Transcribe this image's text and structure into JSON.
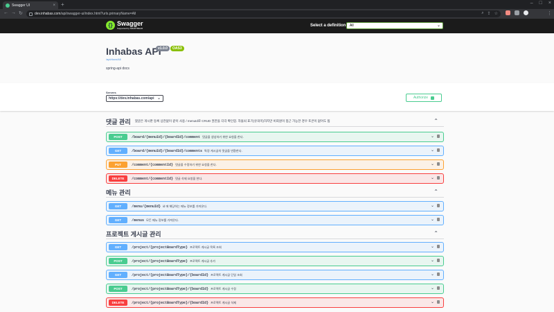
{
  "browser": {
    "tab_title": "Swagger UI",
    "url_host": "dev.inhabas.com",
    "url_path": "/api/swagger-ui/index.html?urls.primaryName=All"
  },
  "topbar": {
    "logo_text": "Swagger",
    "logo_sub": "Supported by SMARTBEAR",
    "definition_label": "Select a definition",
    "definition_value": "All"
  },
  "info": {
    "title": "Inhabas API",
    "version_badge": "v1.0.0",
    "oas_badge": "OAS3",
    "url": "/api/docs/All",
    "description": "spring-api docs"
  },
  "scheme": {
    "servers_label": "Servers",
    "server_value": "https://dev.inhabas.com/api",
    "authorize_label": "Authorize"
  },
  "sections": [
    {
      "name": "댓글 관리",
      "description": "댓글은 게시판 등록 상관없이 같이 사용 / menuId로 CRUD 권한을 각각 확인함. 자물쇠 표기(유의미)하지만 비회원이 접근 가능한 경우 토큰이 없어도 됨",
      "ops": [
        {
          "method": "POST",
          "path": "/board/{menuId}/{boardId}/comment",
          "summary": "댓글을 생성하기 위한 요청을 한다."
        },
        {
          "method": "GET",
          "path": "/board/{menuId}/{boardId}/comments",
          "summary": "특정 게시글의 댓글을 반환한다."
        },
        {
          "method": "PUT",
          "path": "/comment/{commentId}",
          "summary": "댓글을 수정하기 위한 요청을 한다."
        },
        {
          "method": "DELETE",
          "path": "/comment/{commentId}",
          "summary": "댓글 삭제 요청을 한다."
        }
      ]
    },
    {
      "name": "메뉴 관리",
      "description": "",
      "ops": [
        {
          "method": "GET",
          "path": "/menu/{menuId}",
          "summary": "id 에 해당하는 메뉴 정보를 가져온다."
        },
        {
          "method": "GET",
          "path": "/menus",
          "summary": "모든 메뉴 정보를 가져온다."
        }
      ]
    },
    {
      "name": "프로젝트 게시글 관리",
      "description": "",
      "ops": [
        {
          "method": "GET",
          "path": "/project/{projectBoardType}",
          "summary": "프로젝트 게시글 목록 조회"
        },
        {
          "method": "POST",
          "path": "/project/{projectBoardType}",
          "summary": "프로젝트 게시글 추가"
        },
        {
          "method": "GET",
          "path": "/project/{projectBoardType}/{boardId}",
          "summary": "프로젝트 게시글 단일 조회"
        },
        {
          "method": "POST",
          "path": "/project/{projectBoardType}/{boardId}",
          "summary": "프로젝트 게시글 수정"
        },
        {
          "method": "DELETE",
          "path": "/project/{projectBoardType}/{boardId}",
          "summary": "프로젝트 게시글 삭제"
        }
      ]
    }
  ],
  "colors": {
    "GET": "#61affe",
    "POST": "#49cc90",
    "PUT": "#fca130",
    "DELETE": "#f93e3e",
    "swagger_green": "#85ea2d",
    "topbar_bg": "#1b1b1b"
  }
}
